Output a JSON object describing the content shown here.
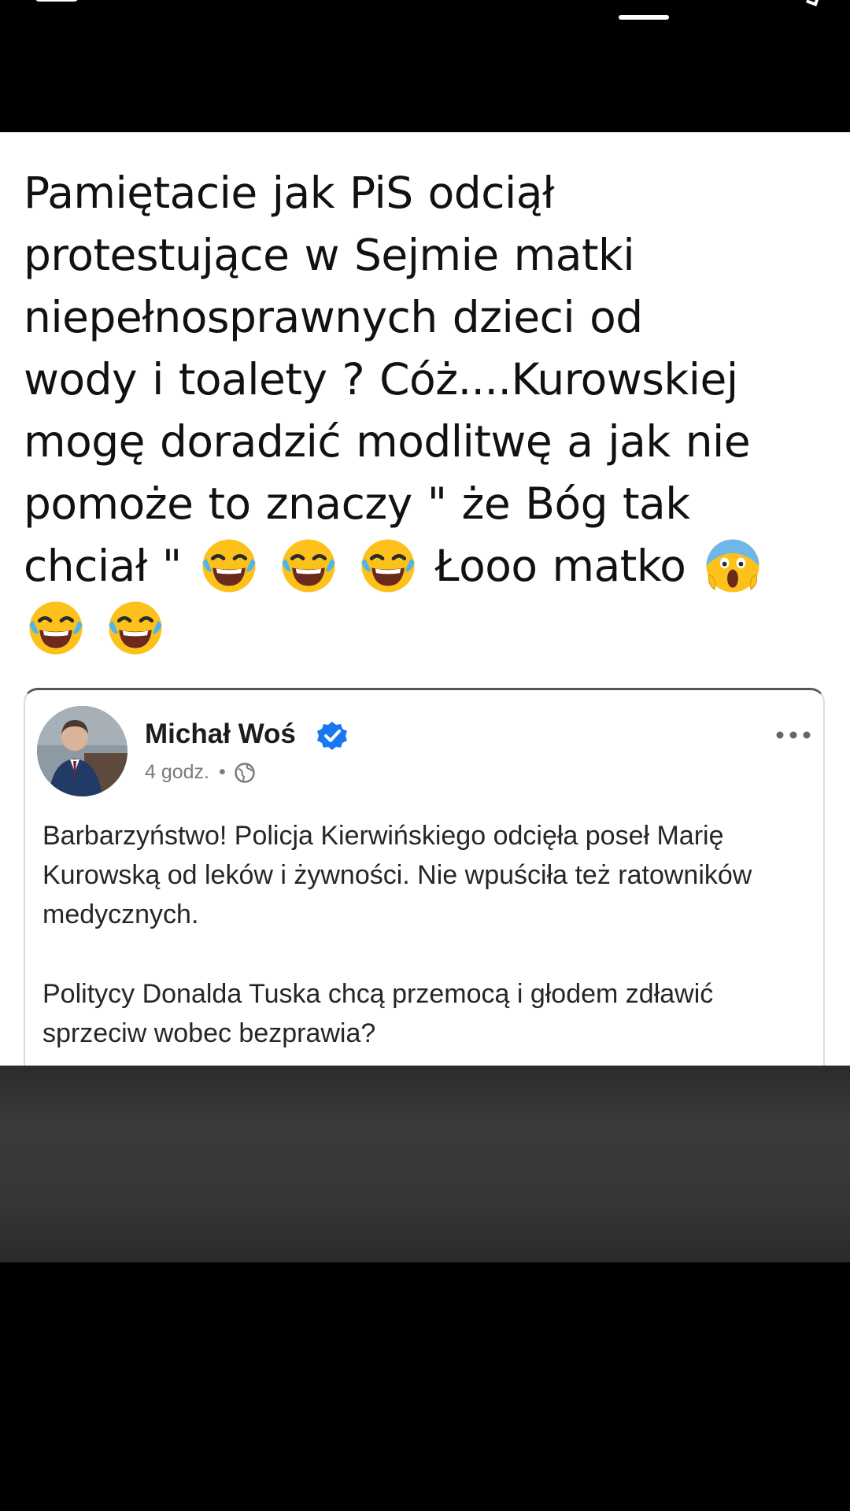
{
  "tweet": {
    "line1": "Pamiętacie jak PiS odciął",
    "line2": "protestujące w Sejmie matki",
    "line3": "niepełnosprawnych dzieci od",
    "line4": "wody i toalety ? Cóż....Kurowskiej",
    "line5": "mogę doradzić modlitwę a jak nie",
    "line6": "pomoże to znaczy \" że Bóg tak",
    "line7_a": "chciał \"",
    "line7_b": "Łooo matko",
    "emoji_laughing": "face-with-tears-of-joy-icon",
    "emoji_scream": "face-screaming-in-fear-icon"
  },
  "facebook_post": {
    "author": "Michał Woś",
    "time": "4 godz.",
    "separator": "•",
    "paragraph1": "Barbarzyństwo! Policja Kierwińskiego odcięła poseł Marię Kurowską od leków i żywności. Nie wpuściła też ratowników medycznych.",
    "paragraph2": "Politycy Donalda Tuska chcą przemocą i głodem zdławić sprzeciw wobec bezprawia?",
    "verified_color": "#1877f2"
  },
  "colors": {
    "background": "#000000",
    "card": "#ffffff",
    "text": "#111111",
    "meta": "#7b7b7b",
    "overlay": "#333333"
  }
}
